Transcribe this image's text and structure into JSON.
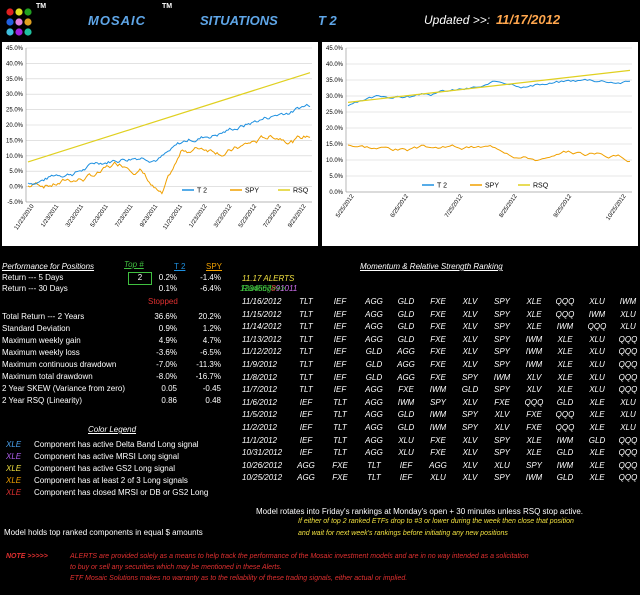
{
  "header": {
    "logo_tm": "TM",
    "brand": "MOSAIC",
    "brand_tm": "TM",
    "situations": "SITUATIONS",
    "model": "T 2",
    "updated_label": "Updated >>:",
    "updated_date": "11/17/2012",
    "logo_colors": [
      "#e02020",
      "#e0e020",
      "#20a020",
      "#2060e0",
      "#e080e0",
      "#e0a020",
      "#40c0e0",
      "#a020e0",
      "#20c0a0"
    ]
  },
  "charts": {
    "left": {
      "y_ticks": [
        "45.0%",
        "40.0%",
        "35.0%",
        "30.0%",
        "25.0%",
        "20.0%",
        "15.0%",
        "10.0%",
        "5.0%",
        "0.0%",
        "-5.0%"
      ],
      "x_ticks": [
        "11/23/2010",
        "1/23/2011",
        "3/23/2011",
        "5/23/2011",
        "7/23/2011",
        "9/23/2011",
        "11/23/2011",
        "1/23/2012",
        "3/23/2012",
        "5/23/2012",
        "7/23/2012",
        "9/23/2012"
      ],
      "legend": [
        "T 2",
        "SPY",
        "RSQ"
      ]
    },
    "right": {
      "y_ticks": [
        "45.0%",
        "40.0%",
        "35.0%",
        "30.0%",
        "25.0%",
        "20.0%",
        "15.0%",
        "10.0%",
        "5.0%",
        "0.0%"
      ],
      "x_ticks": [
        "5/25/2012",
        "6/25/2012",
        "7/25/2012",
        "8/25/2012",
        "9/25/2012",
        "10/25/2012"
      ],
      "legend": [
        "T 2",
        "SPY",
        "RSQ"
      ]
    },
    "colors": {
      "t2": "#1e90e0",
      "spy": "#f0a000",
      "rsq": "#e0d020"
    }
  },
  "performance": {
    "title": "Performance for Positions",
    "top_label": "Top #",
    "top_value": "2",
    "col_t2": "T 2",
    "col_spy": "SPY",
    "stopped": "Stopped",
    "rows": [
      {
        "label": "Return --- 5 Days",
        "t2": "0.2%",
        "spy": "-1.4%"
      },
      {
        "label": "Return --- 30 Days",
        "t2": "0.1%",
        "spy": "-6.4%"
      },
      {
        "label": "Total Return --- 2 Years",
        "t2": "36.6%",
        "spy": "20.2%"
      },
      {
        "label": "Standard Deviation",
        "t2": "0.9%",
        "spy": "1.2%"
      },
      {
        "label": "Maximum weekly gain",
        "t2": "4.9%",
        "spy": "4.7%"
      },
      {
        "label": "Maximum weekly loss",
        "t2": "-3.6%",
        "spy": "-6.5%"
      },
      {
        "label": "Maximum continuous drawdown",
        "t2": "-7.0%",
        "spy": "-11.3%"
      },
      {
        "label": "Maximum total drawdown",
        "t2": "-8.0%",
        "spy": "-16.7%"
      },
      {
        "label": "2 Year SKEW  (Variance from zero)",
        "t2": "0.05",
        "spy": "-0.45"
      },
      {
        "label": "2 Year RSQ  (Linearity)",
        "t2": "0.86",
        "spy": "0.48"
      }
    ]
  },
  "legend": {
    "title": "Color Legend",
    "items": [
      {
        "code": "XLE",
        "color": "#4aa3f0",
        "text": "Component has active Delta Band Long signal"
      },
      {
        "code": "XLE",
        "color": "#b060f0",
        "text": "Component has active MRSI Long signal"
      },
      {
        "code": "XLE",
        "color": "#f0e040",
        "text": "Component has active GS2 Long signal"
      },
      {
        "code": "XLE",
        "color": "#f0a000",
        "text": "Component has at least 2 of 3 Long signals"
      },
      {
        "code": "XLE",
        "color": "#e03030",
        "text": "Component has closed MRSI or DB or GS2 Long"
      }
    ]
  },
  "ranking": {
    "title": "Momentum & Relative Strength Ranking",
    "alerts": "11.17 ALERTS",
    "label": "Ranking>>>",
    "columns": [
      "1",
      "2",
      "3",
      "4",
      "5",
      "6",
      "7",
      "8",
      "9",
      "10",
      "11"
    ],
    "column_colors": [
      "#40c040",
      "#40c040",
      "#40c040",
      "#40c040",
      "#40c040",
      "#40c040",
      "#40c040",
      "#f04040",
      "#d070f0",
      "#d070f0",
      "#d070f0"
    ],
    "rows": [
      {
        "date": "11/16/2012",
        "cells": [
          "TLT",
          "IEF",
          "AGG",
          "GLD",
          "FXE",
          "XLV",
          "SPY",
          "XLE",
          "QQQ",
          "XLU",
          "IWM"
        ]
      },
      {
        "date": "11/15/2012",
        "cells": [
          "TLT",
          "IEF",
          "AGG",
          "GLD",
          "FXE",
          "XLV",
          "SPY",
          "XLE",
          "QQQ",
          "IWM",
          "XLU"
        ]
      },
      {
        "date": "11/14/2012",
        "cells": [
          "TLT",
          "IEF",
          "AGG",
          "GLD",
          "FXE",
          "XLV",
          "SPY",
          "XLE",
          "IWM",
          "QQQ",
          "XLU"
        ]
      },
      {
        "date": "11/13/2012",
        "cells": [
          "TLT",
          "IEF",
          "AGG",
          "GLD",
          "FXE",
          "XLV",
          "SPY",
          "IWM",
          "XLE",
          "XLU",
          "QQQ"
        ]
      },
      {
        "date": "11/12/2012",
        "cells": [
          "TLT",
          "IEF",
          "GLD",
          "AGG",
          "FXE",
          "XLV",
          "SPY",
          "IWM",
          "XLE",
          "XLU",
          "QQQ"
        ]
      },
      {
        "date": "11/9/2012",
        "cells": [
          "TLT",
          "IEF",
          "GLD",
          "AGG",
          "FXE",
          "XLV",
          "SPY",
          "IWM",
          "XLE",
          "XLU",
          "QQQ"
        ]
      },
      {
        "date": "11/8/2012",
        "cells": [
          "TLT",
          "IEF",
          "GLD",
          "AGG",
          "FXE",
          "SPY",
          "IWM",
          "XLV",
          "XLE",
          "XLU",
          "QQQ"
        ]
      },
      {
        "date": "11/7/2012",
        "cells": [
          "TLT",
          "IEF",
          "AGG",
          "FXE",
          "IWM",
          "GLD",
          "SPY",
          "XLV",
          "XLE",
          "XLU",
          "QQQ"
        ]
      },
      {
        "date": "11/6/2012",
        "cells": [
          "IEF",
          "TLT",
          "AGG",
          "IWM",
          "SPY",
          "XLV",
          "FXE",
          "QQQ",
          "GLD",
          "XLE",
          "XLU"
        ]
      },
      {
        "date": "11/5/2012",
        "cells": [
          "IEF",
          "TLT",
          "AGG",
          "GLD",
          "IWM",
          "SPY",
          "XLV",
          "FXE",
          "QQQ",
          "XLE",
          "XLU"
        ]
      },
      {
        "date": "11/2/2012",
        "cells": [
          "IEF",
          "TLT",
          "AGG",
          "GLD",
          "IWM",
          "SPY",
          "XLV",
          "FXE",
          "QQQ",
          "XLE",
          "XLU"
        ]
      },
      {
        "date": "11/1/2012",
        "cells": [
          "IEF",
          "TLT",
          "AGG",
          "XLU",
          "FXE",
          "XLV",
          "SPY",
          "XLE",
          "IWM",
          "GLD",
          "QQQ"
        ]
      },
      {
        "date": "10/31/2012",
        "cells": [
          "IEF",
          "TLT",
          "AGG",
          "XLU",
          "FXE",
          "XLV",
          "SPY",
          "XLE",
          "GLD",
          "XLE",
          "QQQ"
        ]
      },
      {
        "date": "10/26/2012",
        "cells": [
          "AGG",
          "FXE",
          "TLT",
          "IEF",
          "AGG",
          "XLV",
          "XLU",
          "SPY",
          "IWM",
          "XLE",
          "QQQ"
        ]
      },
      {
        "date": "10/25/2012",
        "cells": [
          "AGG",
          "FXE",
          "TLT",
          "IEF",
          "XLU",
          "XLV",
          "SPY",
          "IWM",
          "GLD",
          "XLE",
          "QQQ"
        ]
      }
    ]
  },
  "footer": {
    "model_rotates": "Model rotates into Friday's rankings at Monday's open + 30 minutes unless RSQ stop active.",
    "top2_line1": "If either of top 2 ranked ETFs drop to #3 or lower during the week then close that position",
    "top2_line2": "and wait for next week's rankings before initiating any new positions",
    "model_holds": "Model holds top ranked  components in equal  $ amounts",
    "note_label": "NOTE  >>>>>",
    "note_line1": "ALERTS  are provided solely as a means to help track the performance of the Mosaic investment models and are in no way intended as a solicitation",
    "note_line2": "to buy or sell any securities which may be mentioned in these Alerts.",
    "note_line3": "ETF Mosaic Solutions makes no warranty as to the reliability of these trading signals, either actual or implied."
  }
}
